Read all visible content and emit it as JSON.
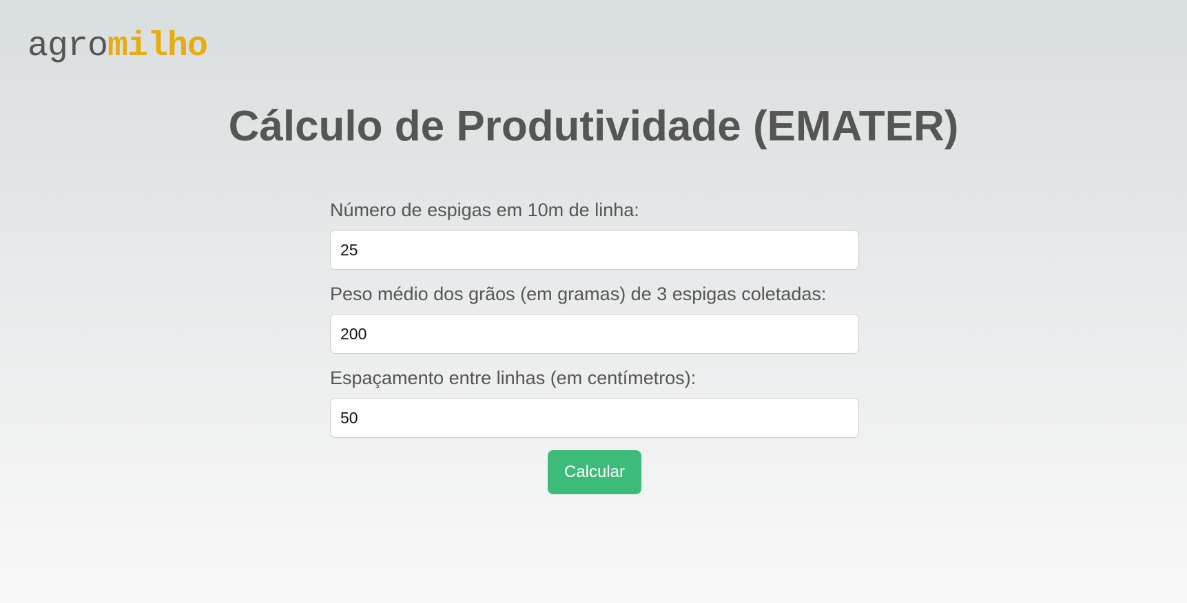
{
  "logo": {
    "part_a": "agro",
    "part_b": "milho"
  },
  "page_title": "Cálculo de Produtividade (EMATER)",
  "form": {
    "fields": [
      {
        "label": "Número de espigas em 10m de linha:",
        "value": "25"
      },
      {
        "label": "Peso médio dos grãos (em gramas) de 3 espigas coletadas:",
        "value": "200"
      },
      {
        "label": "Espaçamento entre linhas (em centímetros):",
        "value": "50"
      }
    ],
    "submit_label": "Calcular"
  },
  "colors": {
    "accent_logo": "#e5ad12",
    "button": "#3dbb7a",
    "text": "#555555"
  }
}
